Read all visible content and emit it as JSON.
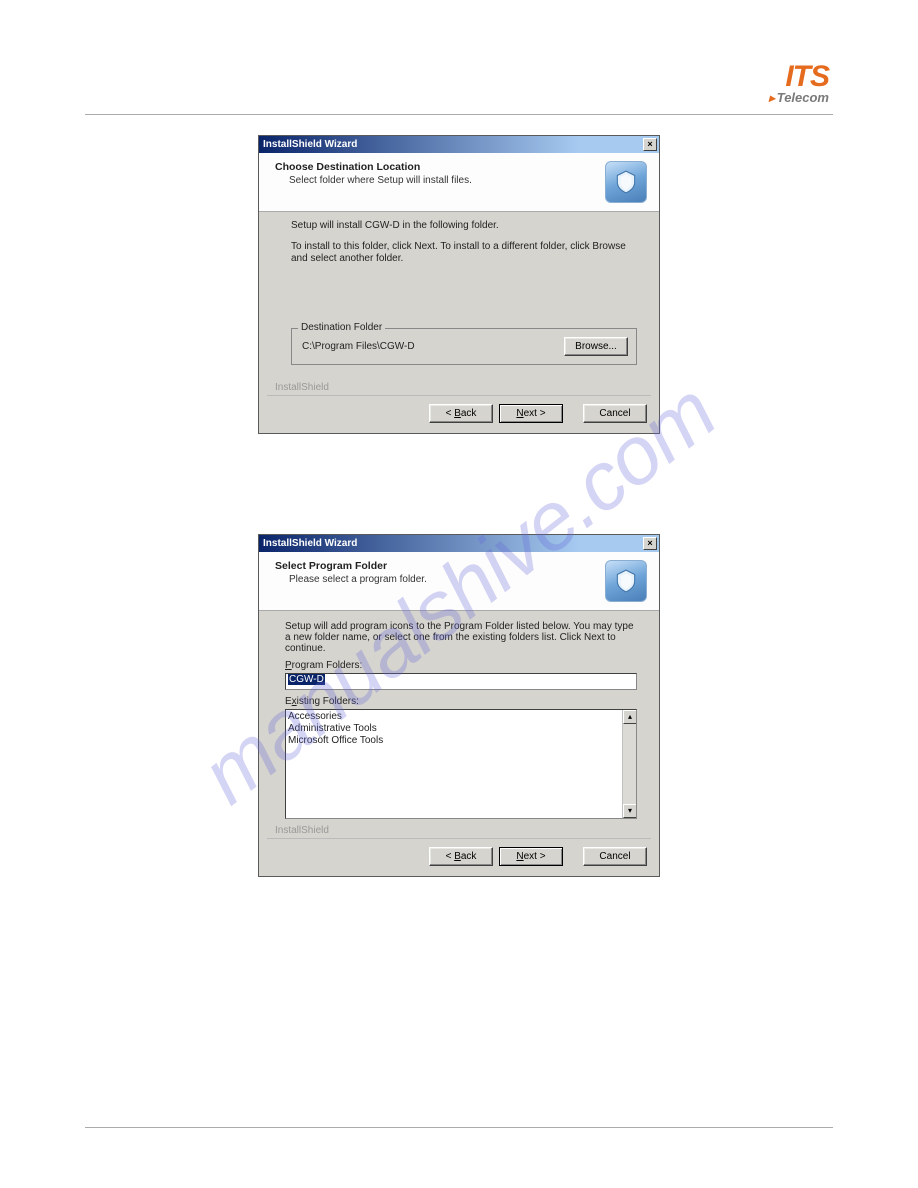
{
  "logo": {
    "brand": "ITS",
    "sub": "Telecom"
  },
  "watermark": "manualshive.com",
  "dialog1": {
    "titlebar": "InstallShield Wizard",
    "header_title": "Choose Destination Location",
    "header_sub": "Select folder where Setup will install files.",
    "body_line1": "Setup will install CGW-D in the following folder.",
    "body_line2": "To install to this folder, click Next. To install to a different folder, click Browse and select another folder.",
    "group_legend": "Destination Folder",
    "dest_path": "C:\\Program Files\\CGW-D",
    "browse_btn": "Browse...",
    "back_btn": "< Back",
    "next_btn": "Next >",
    "cancel_btn": "Cancel",
    "installshield_label": "InstallShield"
  },
  "dialog2": {
    "titlebar": "InstallShield Wizard",
    "header_title": "Select Program Folder",
    "header_sub": "Please select a program folder.",
    "body_text": "Setup will add program icons to the Program Folder listed below. You may type a new folder name, or select one from the existing folders list. Click Next to continue.",
    "pf_label": "Program Folders:",
    "pf_value": "CGW-D",
    "ef_label": "Existing Folders:",
    "existing": [
      "Accessories",
      "Administrative Tools",
      "Microsoft Office Tools"
    ],
    "back_btn": "< Back",
    "next_btn": "Next >",
    "cancel_btn": "Cancel",
    "installshield_label": "InstallShield"
  }
}
